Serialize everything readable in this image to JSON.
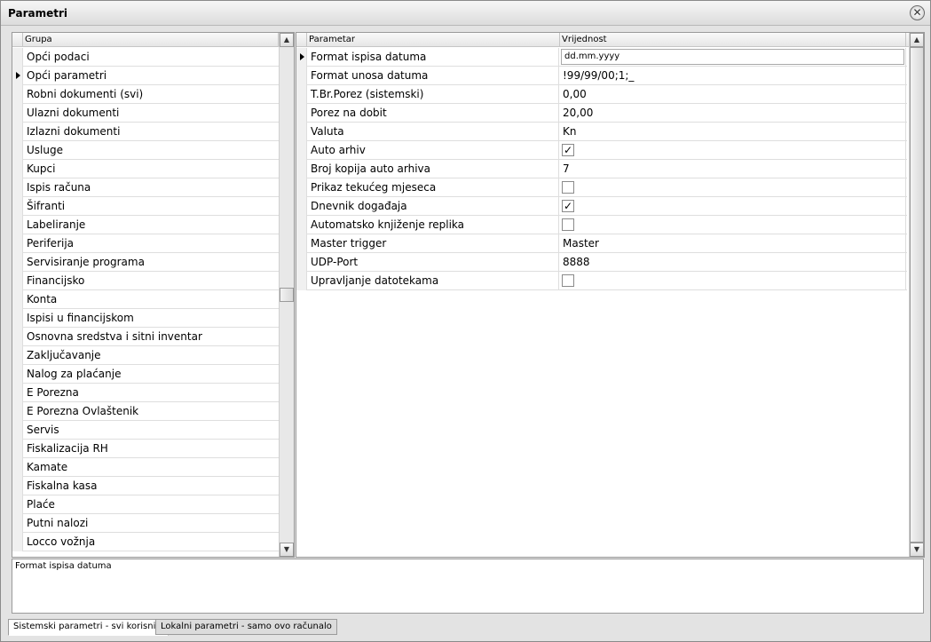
{
  "window": {
    "title": "Parametri"
  },
  "left_grid": {
    "header": "Grupa",
    "selected_index": 1,
    "items": [
      "Opći podaci",
      "Opći parametri",
      "Robni dokumenti (svi)",
      "Ulazni dokumenti",
      "Izlazni dokumenti",
      "Usluge",
      "Kupci",
      "Ispis računa",
      "Šifranti",
      "Labeliranje",
      "Periferija",
      "Servisiranje programa",
      "Financijsko",
      "Konta",
      "Ispisi u financijskom",
      "Osnovna sredstva i sitni inventar",
      "Zaključavanje",
      "Nalog za plaćanje",
      "E Porezna",
      "E Porezna Ovlaštenik",
      "Servis",
      "Fiskalizacija RH",
      "Kamate",
      "Fiskalna kasa",
      "Plaće",
      "Putni nalozi",
      "Locco vožnja"
    ]
  },
  "right_grid": {
    "headers": {
      "param": "Parametar",
      "value": "Vrijednost"
    },
    "selected_index": 0,
    "rows": [
      {
        "name": "Format ispisa datuma",
        "type": "edit",
        "value": "dd.mm.yyyy"
      },
      {
        "name": "Format unosa datuma",
        "type": "text",
        "value": "!99/99/00;1;_"
      },
      {
        "name": "T.Br.Porez (sistemski)",
        "type": "text",
        "value": "0,00"
      },
      {
        "name": "Porez na dobit",
        "type": "text",
        "value": "20,00"
      },
      {
        "name": "Valuta",
        "type": "text",
        "value": "Kn"
      },
      {
        "name": "Auto arhiv",
        "type": "check",
        "checked": true
      },
      {
        "name": "Broj kopija auto arhiva",
        "type": "text",
        "value": "7"
      },
      {
        "name": "Prikaz tekućeg mjeseca",
        "type": "check",
        "checked": false
      },
      {
        "name": "Dnevnik događaja",
        "type": "check",
        "checked": true
      },
      {
        "name": "Automatsko knjiženje replika",
        "type": "check",
        "checked": false
      },
      {
        "name": "Master trigger",
        "type": "text",
        "value": "Master"
      },
      {
        "name": "UDP-Port",
        "type": "text",
        "value": "8888"
      },
      {
        "name": "Upravljanje datotekama",
        "type": "check",
        "checked": false
      }
    ]
  },
  "description": {
    "text": "Format ispisa datuma"
  },
  "tabs": [
    {
      "label": "Sistemski parametri - svi korisnici",
      "active": true
    },
    {
      "label": "Lokalni parametri - samo ovo računalo",
      "active": false
    }
  ],
  "icons": {
    "close": "close-icon",
    "scroll_up": "arrow-up-icon",
    "scroll_down": "arrow-down-icon"
  }
}
